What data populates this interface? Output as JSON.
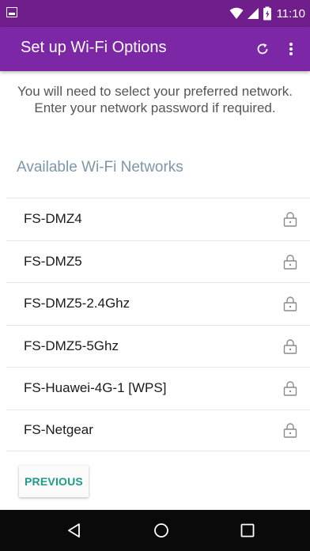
{
  "status_bar": {
    "time": "11:10",
    "icons": [
      "notification-icon",
      "wifi-icon",
      "signal-icon",
      "battery-icon"
    ]
  },
  "app_bar": {
    "title": "Set up Wi-Fi Options",
    "actions": [
      "refresh-icon",
      "more-vert-icon"
    ],
    "background": "#7b27a6",
    "status_background": "#6f1e8c"
  },
  "intro_text": "You will need to select your preferred network. Enter your network password if required.",
  "section_title": "Available Wi-Fi Networks",
  "networks": [
    {
      "name": "FS-DMZ4",
      "secured": true
    },
    {
      "name": "FS-DMZ5",
      "secured": true
    },
    {
      "name": "FS-DMZ5-2.4Ghz",
      "secured": true
    },
    {
      "name": "FS-DMZ5-5Ghz",
      "secured": true
    },
    {
      "name": "FS-Huawei-4G-1 [WPS]",
      "secured": true
    },
    {
      "name": "FS-Netgear",
      "secured": true
    }
  ],
  "previous_button": "PREVIOUS",
  "accent_color": "#1f9a88",
  "nav_bar": [
    "back-icon",
    "home-icon",
    "recent-apps-icon"
  ]
}
